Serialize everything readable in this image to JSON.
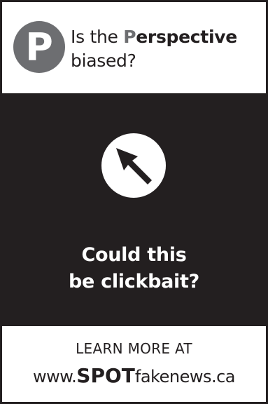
{
  "header": {
    "badge_letter": "P",
    "line1_prefix": "Is the ",
    "line1_highlight": "P",
    "line1_suffix": "erspective",
    "line2": "biased?"
  },
  "main": {
    "icon": "cursor-arrow-icon",
    "headline_line1": "Could this",
    "headline_line2": "be clickbait?"
  },
  "footer": {
    "cta": "LEARN MORE AT",
    "url_prefix": "www.",
    "url_brand": "SPOT",
    "url_suffix": "fakenews.ca"
  },
  "colors": {
    "background": "#231f20",
    "panel": "#ffffff",
    "accent_gray": "#6d6e71",
    "text": "#231f20"
  }
}
